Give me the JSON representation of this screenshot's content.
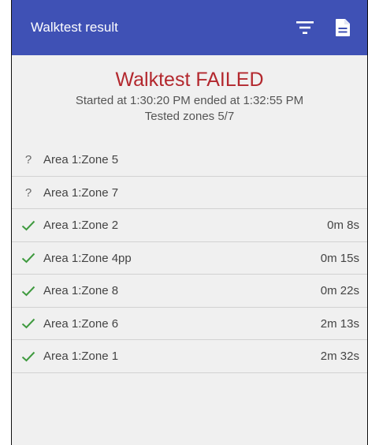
{
  "appbar": {
    "title": "Walktest result",
    "color": "#3f51b5",
    "actions": [
      "filter-icon",
      "document-icon"
    ]
  },
  "summary": {
    "status": "Walktest FAILED",
    "status_color": "#b3282e",
    "times": "Started at 1:30:20 PM ended at 1:32:55 PM",
    "zones": "Tested zones 5/7"
  },
  "zones": [
    {
      "icon": "question-icon",
      "symbol": "?",
      "name": "Area 1:Zone 5",
      "time": ""
    },
    {
      "icon": "question-icon",
      "symbol": "?",
      "name": "Area 1:Zone 7",
      "time": ""
    },
    {
      "icon": "check-icon",
      "symbol": "✓",
      "name": "Area 1:Zone 2",
      "time": "0m 8s"
    },
    {
      "icon": "check-icon",
      "symbol": "✓",
      "name": "Area 1:Zone 4pp",
      "time": "0m 15s"
    },
    {
      "icon": "check-icon",
      "symbol": "✓",
      "name": "Area 1:Zone 8",
      "time": "0m 22s"
    },
    {
      "icon": "check-icon",
      "symbol": "✓",
      "name": "Area 1:Zone 6",
      "time": "2m 13s"
    },
    {
      "icon": "check-icon",
      "symbol": "✓",
      "name": "Area 1:Zone 1",
      "time": "2m 32s"
    }
  ],
  "colors": {
    "check": "#3f9a3f",
    "background": "#f0f0f0"
  }
}
